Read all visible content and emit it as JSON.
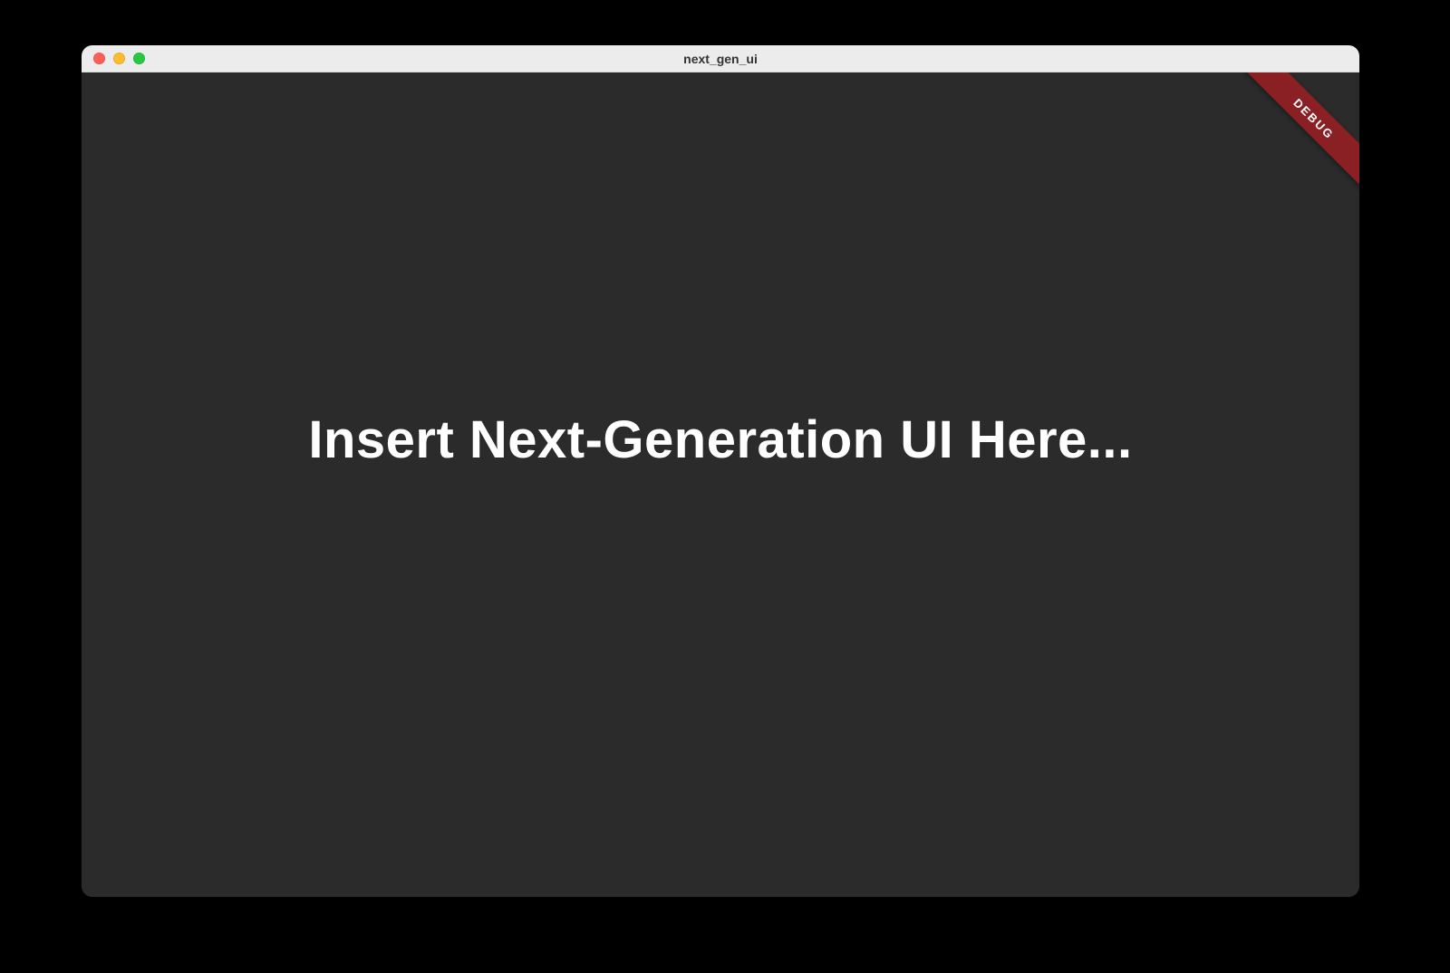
{
  "window": {
    "title": "next_gen_ui"
  },
  "content": {
    "headline": "Insert Next-Generation UI Here..."
  },
  "ribbon": {
    "label": "DEBUG"
  }
}
